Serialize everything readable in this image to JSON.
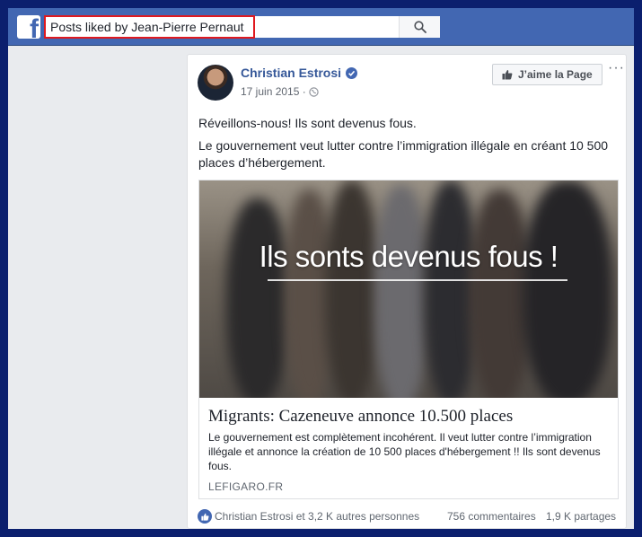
{
  "topbar": {
    "logo_letter": "f",
    "search": {
      "value": "Posts liked by Jean-Pierre Pernaut",
      "icon": "search-icon"
    },
    "colors": {
      "bar": "#4267b2",
      "highlight": "#e0191f"
    }
  },
  "post": {
    "author": "Christian Estrosi",
    "date": "17 juin 2015 ·",
    "like_page_label": "J’aime la Page",
    "more_label": "···",
    "text_line1": "Réveillons-nous! Ils sont devenus fous.",
    "text_line2": "Le gouvernement veut lutter contre l’immigration illégale en créant 10 500 places d’hébergement.",
    "link": {
      "image_caption": "Ils sonts devenus fous !",
      "title": "Migrants: Cazeneuve annonce 10.500 places",
      "description": "Le gouvernement est complètement incohérent. Il veut lutter contre l’immigration illégale et annonce la création de 10 500 places d'hébergement !! Ils sont devenus fous.",
      "source": "LEFIGARO.FR"
    },
    "footer": {
      "likes": "Christian Estrosi et 3,2 K autres personnes",
      "comments": "756 commentaires",
      "shares": "1,9 K partages"
    }
  }
}
